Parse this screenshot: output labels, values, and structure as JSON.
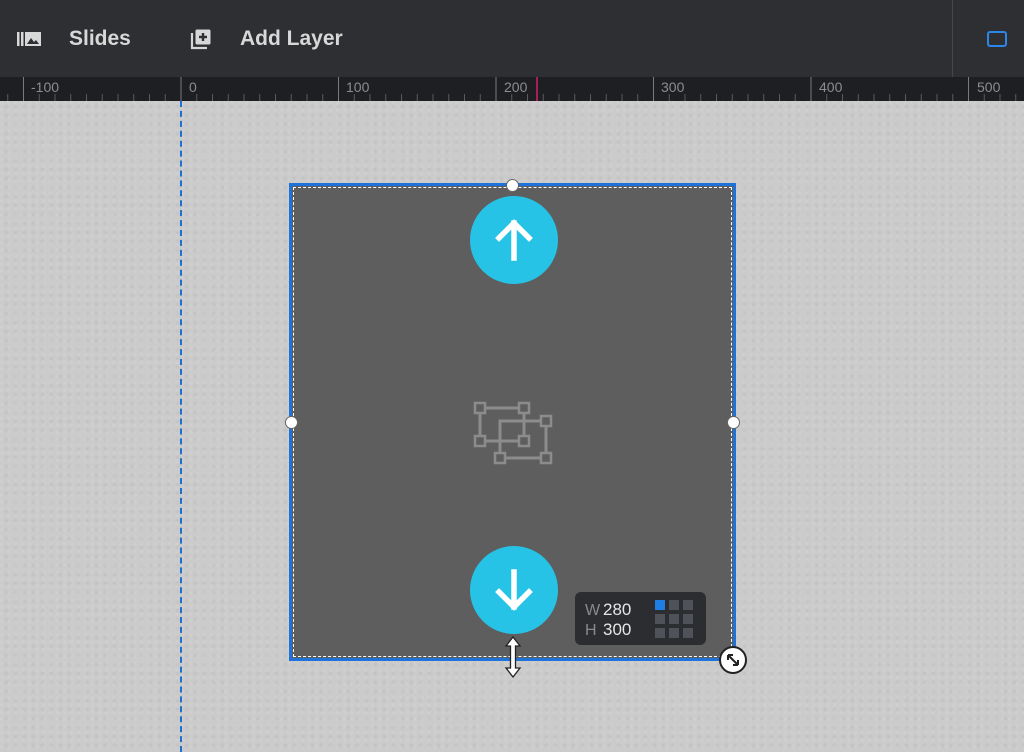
{
  "toolbar": {
    "slides_label": "Slides",
    "slides_icon": "slides-library-icon",
    "add_layer_label": "Add Layer",
    "add_layer_icon": "add-layer-icon",
    "device_icon": "desktop-device-icon"
  },
  "ruler": {
    "labels": [
      "-100",
      "0",
      "100",
      "200",
      "300",
      "400",
      "500"
    ]
  },
  "layer": {
    "up_icon": "arrow-up-icon",
    "down_icon": "arrow-down-icon",
    "placeholder_icon": "group-layer-icon"
  },
  "size_panel": {
    "w_label": "W",
    "w_value": "280",
    "h_label": "H",
    "h_value": "300"
  },
  "colors": {
    "toolbar_bg": "#2e2f33",
    "accent_blue": "#1f73d8",
    "arrow_cyan": "#27c3e6",
    "layer_bg": "#5e5e5e"
  }
}
